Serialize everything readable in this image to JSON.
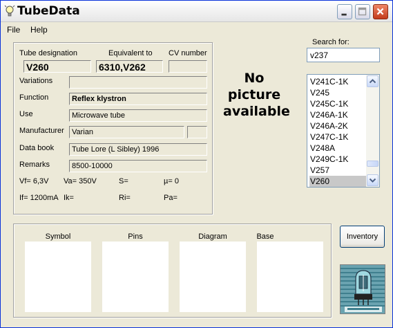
{
  "window": {
    "title": "TubeData"
  },
  "menu": {
    "file": "File",
    "help": "Help"
  },
  "tube": {
    "designation_label": "Tube designation",
    "designation": "V260",
    "equivalent_label": "Equivalent to",
    "equivalent": "6310,V262",
    "cv_label": "CV number",
    "cv": "",
    "variations_label": "Variations",
    "variations": "",
    "function_label": "Function",
    "function": "Reflex klystron",
    "use_label": "Use",
    "use": "Microwave tube",
    "manufacturer_label": "Manufacturer",
    "manufacturer": "Varian",
    "manufacturer_extra": "",
    "databook_label": "Data book",
    "databook": "Tube Lore (L Sibley) 1996",
    "remarks_label": "Remarks",
    "remarks": "8500-10000"
  },
  "params": {
    "vf": "Vf= 6,3V",
    "va": "Va= 350V",
    "s": "S=",
    "mu": "µ=   0",
    "if": "If= 1200mA",
    "ik": "Ik=",
    "ri": "Ri=",
    "pa": "Pa="
  },
  "no_picture": {
    "line1": "No",
    "line2": "picture",
    "line3": "available"
  },
  "search": {
    "label": "Search for:",
    "value": "v237"
  },
  "tube_list": {
    "items": [
      "V241C-1K",
      "V245",
      "V245C-1K",
      "V246A-1K",
      "V246A-2K",
      "V247C-1K",
      "V248A",
      "V249C-1K",
      "V257",
      "V260"
    ],
    "selected": "V260"
  },
  "panels": {
    "symbol": "Symbol",
    "pins": "Pins",
    "diagram": "Diagram",
    "base": "Base"
  },
  "buttons": {
    "inventory": "Inventory"
  },
  "icons": {
    "app": "lightbulb-icon",
    "minimize": "minimize-icon",
    "maximize": "maximize-icon",
    "close": "close-icon",
    "scroll_up": "arrow-up-icon",
    "scroll_down": "arrow-down-icon",
    "logo": "vacuum-tube-logo"
  },
  "colors": {
    "window_border": "#0831d9",
    "close_button": "#c23a1b",
    "list_selection": "#c8c8c8",
    "logo_teal": "#5d9aa8"
  }
}
